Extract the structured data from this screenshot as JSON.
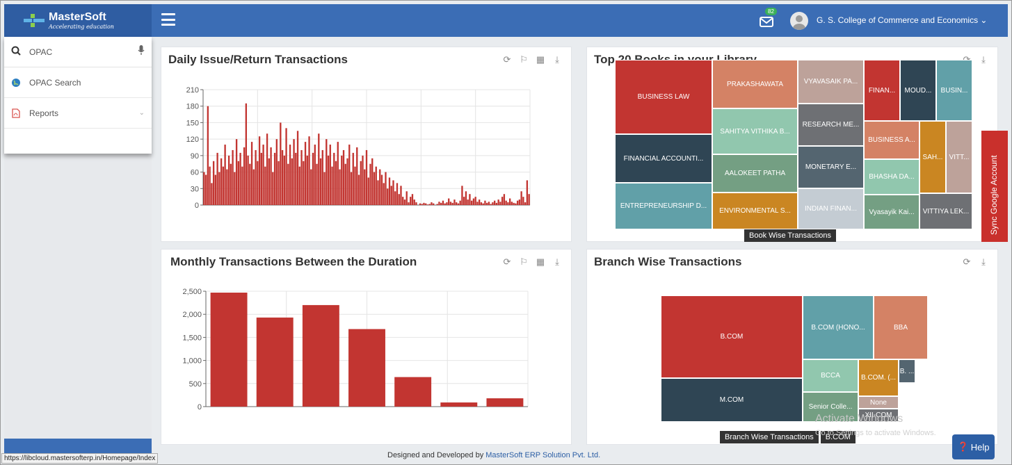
{
  "header": {
    "brand": "MasterSoft",
    "tagline": "Accelerating education",
    "mail_count": "82",
    "org_name": "G. S. College of Commerce and Economics ⌄"
  },
  "sidebar": {
    "search_label": "OPAC",
    "items": [
      {
        "label": "OPAC Search"
      },
      {
        "label": "Reports"
      }
    ]
  },
  "status_url": "https://libcloud.mastersofterp.in/Homepage/Index",
  "cards": {
    "daily": {
      "title": "Daily Issue/Return Transactions"
    },
    "top20": {
      "title": "Top 20 Books in your Library",
      "tooltip": "Book Wise Transactions"
    },
    "monthly": {
      "title": "Monthly Transactions Between the Duration"
    },
    "branch": {
      "title": "Branch Wise Transactions",
      "breadcrumb_root": "Branch Wise Transactions",
      "breadcrumb_current": "B.COM"
    }
  },
  "chart_data": [
    {
      "type": "bar",
      "title": "Daily Issue/Return Transactions",
      "ylim": [
        0,
        210
      ],
      "yticks": [
        0,
        30,
        60,
        90,
        120,
        150,
        180,
        210
      ],
      "grid": true,
      "values": [
        60,
        55,
        180,
        70,
        40,
        80,
        55,
        95,
        60,
        85,
        70,
        110,
        65,
        90,
        75,
        100,
        60,
        120,
        80,
        95,
        70,
        105,
        185,
        90,
        75,
        115,
        65,
        100,
        80,
        125,
        95,
        110,
        70,
        130,
        85,
        105,
        60,
        95,
        120,
        80,
        150,
        100,
        90,
        140,
        75,
        110,
        85,
        120,
        95,
        135,
        70,
        100,
        80,
        115,
        90,
        125,
        65,
        95,
        110,
        75,
        130,
        85,
        100,
        60,
        120,
        90,
        110,
        70,
        95,
        80,
        115,
        65,
        90,
        100,
        75,
        85,
        110,
        60,
        95,
        70,
        105,
        55,
        80,
        90,
        65,
        100,
        50,
        75,
        85,
        60,
        70,
        45,
        65,
        55,
        40,
        60,
        30,
        50,
        35,
        45,
        25,
        40,
        20,
        35,
        15,
        10,
        25,
        5,
        15,
        20,
        10,
        5,
        0,
        3,
        2,
        4,
        3,
        1,
        2,
        5,
        3,
        0,
        2,
        6,
        4,
        8,
        3,
        5,
        12,
        6,
        4,
        10,
        5,
        3,
        8,
        35,
        15,
        25,
        10,
        20,
        8,
        12,
        15,
        6,
        10,
        5,
        3,
        8,
        4,
        6,
        2,
        5,
        8,
        4,
        10,
        6,
        15,
        20,
        8,
        5,
        12,
        6,
        4,
        3,
        8,
        10,
        25,
        15,
        5,
        45,
        20
      ]
    },
    {
      "type": "bar",
      "title": "Monthly Transactions Between the Duration",
      "ylim": [
        0,
        2500
      ],
      "yticks": [
        0,
        500,
        1000,
        1500,
        2000,
        2500
      ],
      "ytick_labels": [
        "0",
        "500",
        "1,000",
        "1,500",
        "2,000",
        "2,500"
      ],
      "grid": true,
      "values": [
        2470,
        1930,
        2200,
        1680,
        640,
        90,
        180
      ]
    },
    {
      "type": "treemap",
      "title": "Top 20 Books in your Library",
      "cells": [
        {
          "label": "BUSINESS LAW",
          "color": "#c23531"
        },
        {
          "label": "FINANCIAL ACCOUNTI...",
          "color": "#2f4554"
        },
        {
          "label": "ENTREPRENEURSHIP D...",
          "color": "#61a0a8"
        },
        {
          "label": "PRAKASHAWATA",
          "color": "#d48265"
        },
        {
          "label": "SAHITYA VITHIKA B...",
          "color": "#91c7ae"
        },
        {
          "label": "AALOKEET PATHA",
          "color": "#749f83"
        },
        {
          "label": "ENVIRONMENTAL S...",
          "color": "#ca8622"
        },
        {
          "label": "VYAVASAIK PA...",
          "color": "#bda29a"
        },
        {
          "label": "RESEARCH ME...",
          "color": "#6e7074"
        },
        {
          "label": "MONETARY E...",
          "color": "#546570"
        },
        {
          "label": "INDIAN FINAN...",
          "color": "#c4ccd3"
        },
        {
          "label": "FINAN...",
          "color": "#c23531"
        },
        {
          "label": "MOUD...",
          "color": "#2f4554"
        },
        {
          "label": "BUSIN...",
          "color": "#61a0a8"
        },
        {
          "label": "BUSINESS A...",
          "color": "#d48265"
        },
        {
          "label": "BHASHA DA...",
          "color": "#91c7ae"
        },
        {
          "label": "Vyasayik Kai...",
          "color": "#749f83"
        },
        {
          "label": "SAH...",
          "color": "#ca8622"
        },
        {
          "label": "VITT...",
          "color": "#bda29a"
        },
        {
          "label": "VITTIYA LEK...",
          "color": "#6e7074"
        }
      ]
    },
    {
      "type": "treemap",
      "title": "Branch Wise Transactions",
      "cells": [
        {
          "label": "B.COM",
          "color": "#c23531"
        },
        {
          "label": "M.COM",
          "color": "#2f4554"
        },
        {
          "label": "B.COM (HONO...",
          "color": "#61a0a8"
        },
        {
          "label": "BBA",
          "color": "#d48265"
        },
        {
          "label": "BCCA",
          "color": "#91c7ae"
        },
        {
          "label": "Senior Colle...",
          "color": "#749f83"
        },
        {
          "label": "B.COM. (...",
          "color": "#ca8622"
        },
        {
          "label": "None",
          "color": "#bda29a"
        },
        {
          "label": "XII-COM",
          "color": "#6e7074"
        },
        {
          "label": "B. ...",
          "color": "#546570"
        }
      ]
    }
  ],
  "watermark": {
    "line1": "Activate Windows",
    "line2": "Go to Settings to activate Windows."
  },
  "sync_label": "Sync Google Account",
  "help_label": "Help",
  "footer": {
    "prefix": "Designed and Developed by ",
    "company": "MasterSoft ERP Solution Pvt. Ltd."
  },
  "colors": {
    "header": "#3b6db5",
    "bar": "#c23531",
    "sync": "#c9302c"
  }
}
